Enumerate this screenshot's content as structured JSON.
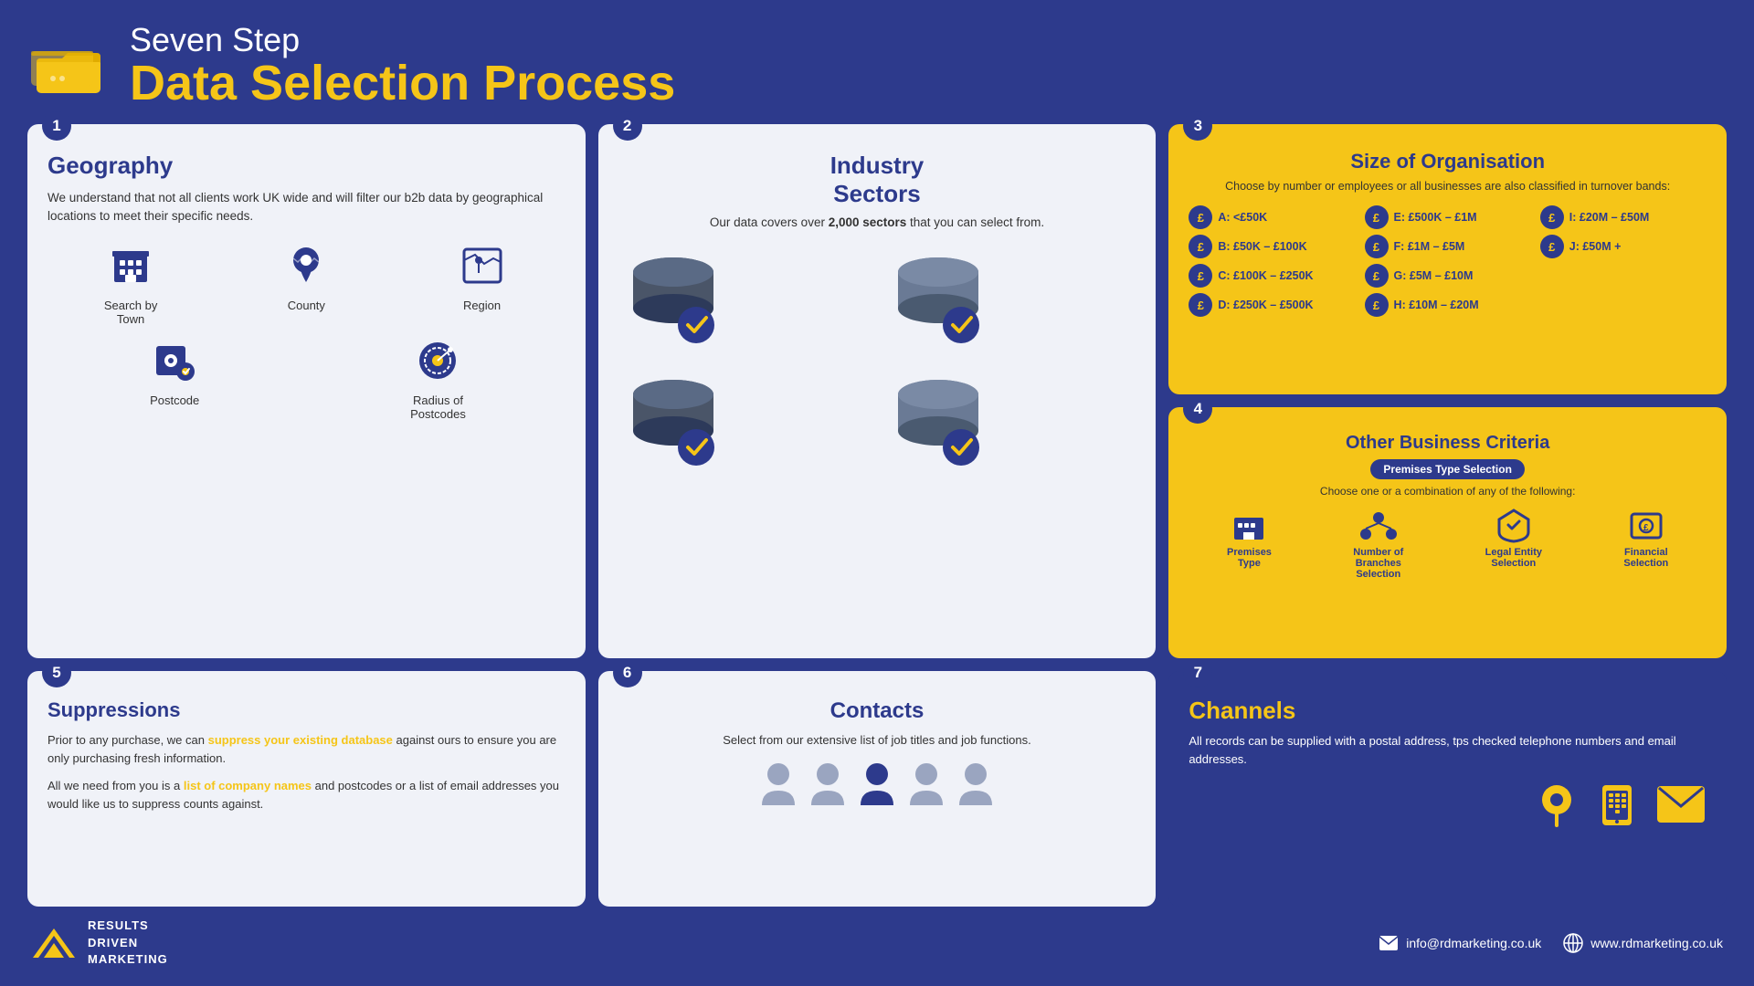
{
  "header": {
    "subtitle": "Seven Step",
    "title": "Data Selection Process"
  },
  "steps": {
    "s1": {
      "num": "1",
      "title": "Geography",
      "desc": "We understand that not all clients work UK wide and will filter our b2b data by geographical locations to meet their specific needs.",
      "geo_items": [
        {
          "label": "Search by Town"
        },
        {
          "label": "County"
        },
        {
          "label": "Region"
        },
        {
          "label": "Postcode"
        },
        {
          "label": "Radius of Postcodes"
        }
      ]
    },
    "s2": {
      "num": "2",
      "title": "Industry\nSectors",
      "desc_prefix": "Our data covers over ",
      "desc_bold": "2,000 sectors",
      "desc_suffix": " that you can select from."
    },
    "s3": {
      "num": "3",
      "title": "Size of Organisation",
      "subtitle": "Choose by number or employees or all businesses are also classified in turnover bands:",
      "bands": [
        {
          "label": "A: <£50K"
        },
        {
          "label": "E: £500K – £1M"
        },
        {
          "label": "I: £20M – £50M"
        },
        {
          "label": "B: £50K – £100K"
        },
        {
          "label": "F: £1M – £5M"
        },
        {
          "label": "J: £50M +"
        },
        {
          "label": "C: £100K – £250K"
        },
        {
          "label": "G: £5M – £10M"
        },
        {
          "label": ""
        },
        {
          "label": "D: £250K – £500K"
        },
        {
          "label": "H: £10M – £20M"
        },
        {
          "label": ""
        }
      ]
    },
    "s4": {
      "num": "4",
      "title": "Other Business Criteria",
      "badge": "Premises Type Selection",
      "choose_text": "Choose one or a combination of any of the following:",
      "items": [
        {
          "label": "Premises\nType"
        },
        {
          "label": "Number of\nBranches\nSelection"
        },
        {
          "label": "Legal Entity\nSelection"
        },
        {
          "label": "Financial\nSelection"
        }
      ]
    },
    "s5": {
      "num": "5",
      "title": "Suppressions",
      "p1": "Prior to any purchase, we can suppress your existing database against ours to ensure you are only purchasing fresh information.",
      "p2_prefix": "All we need from you is a ",
      "p2_link": "list of company names",
      "p2_suffix": " and postcodes or a list of email addresses you would like us to suppress counts against."
    },
    "s6": {
      "num": "6",
      "title": "Contacts",
      "desc": "Select from our extensive list of job titles and job functions."
    },
    "s7": {
      "num": "7",
      "title": "Channels",
      "desc": "All records can be supplied with a postal address, tps checked telephone numbers and email addresses."
    }
  },
  "footer": {
    "logo_lines": [
      "RESULTS",
      "DRIVEN",
      "MARKETING"
    ],
    "email": "info@rdmarketing.co.uk",
    "website": "www.rdmarketing.co.uk"
  }
}
